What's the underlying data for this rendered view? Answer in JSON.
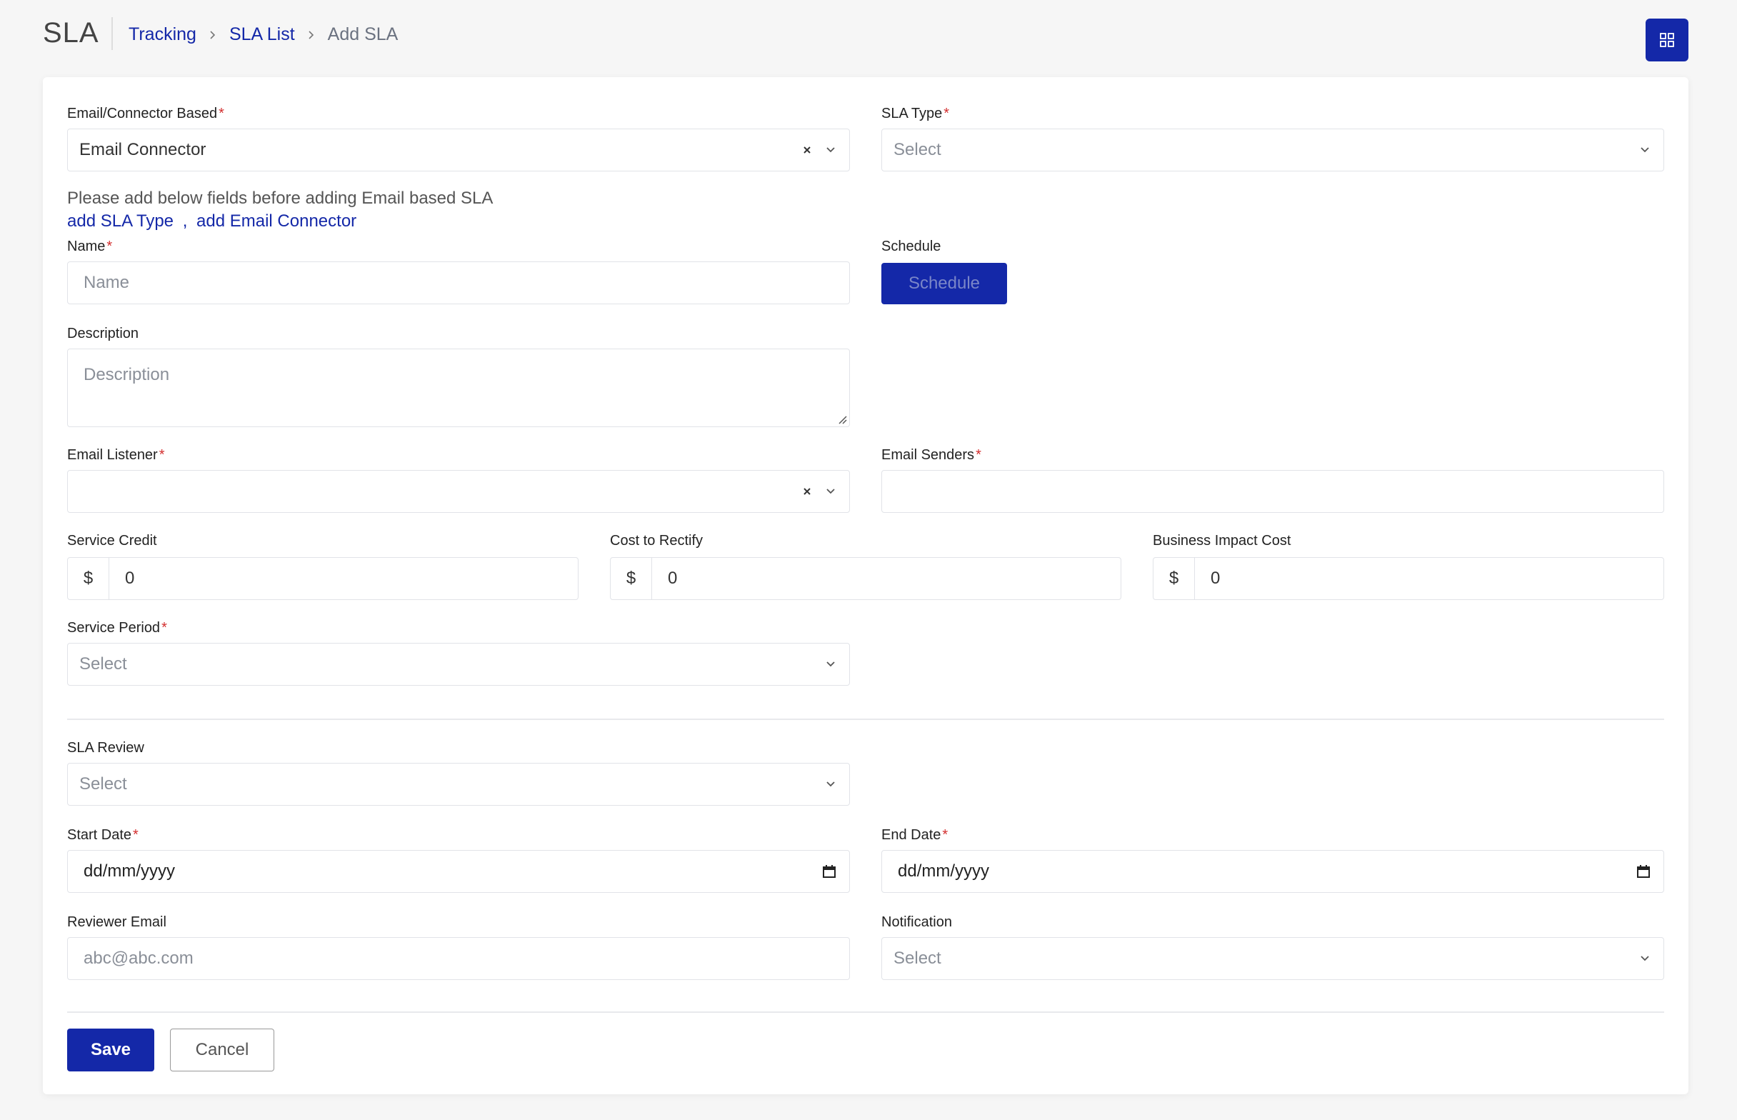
{
  "header": {
    "title": "SLA",
    "breadcrumb": {
      "tracking": "Tracking",
      "sla_list": "SLA List",
      "current": "Add SLA"
    }
  },
  "form": {
    "email_connector_based": {
      "label": "Email/Connector Based",
      "required": "*",
      "value": "Email Connector"
    },
    "sla_type": {
      "label": "SLA Type",
      "required": "*",
      "placeholder": "Select"
    },
    "info": {
      "text": "Please add below fields before adding Email based SLA",
      "link_sla_type": "add SLA Type",
      "separator": ",",
      "link_email_connector": "add Email Connector"
    },
    "name": {
      "label": "Name",
      "required": "*",
      "placeholder": "Name"
    },
    "schedule": {
      "label": "Schedule",
      "button": "Schedule"
    },
    "description": {
      "label": "Description",
      "placeholder": "Description"
    },
    "email_listener": {
      "label": "Email Listener",
      "required": "*",
      "value": ""
    },
    "email_senders": {
      "label": "Email Senders",
      "required": "*",
      "value": ""
    },
    "service_credit": {
      "label": "Service Credit",
      "symbol": "$",
      "value": "0"
    },
    "cost_to_rectify": {
      "label": "Cost to Rectify",
      "symbol": "$",
      "value": "0"
    },
    "business_impact_cost": {
      "label": "Business Impact Cost",
      "symbol": "$",
      "value": "0"
    },
    "service_period": {
      "label": "Service Period",
      "required": "*",
      "placeholder": "Select"
    },
    "sla_review": {
      "label": "SLA Review",
      "placeholder": "Select"
    },
    "start_date": {
      "label": "Start Date",
      "required": "*",
      "value": "dd/mm/yyyy"
    },
    "end_date": {
      "label": "End Date",
      "required": "*",
      "value": "dd/mm/yyyy"
    },
    "reviewer_email": {
      "label": "Reviewer Email",
      "placeholder": "abc@abc.com"
    },
    "notification": {
      "label": "Notification",
      "placeholder": "Select"
    }
  },
  "actions": {
    "save": "Save",
    "cancel": "Cancel"
  },
  "colors": {
    "primary": "#1428a8",
    "required": "#d32f2f",
    "border": "#e1e3e8",
    "background": "#f6f6f6"
  },
  "icons": [
    "chevron-right-icon",
    "grid-icon",
    "clear-icon",
    "chevron-down-icon",
    "calendar-icon",
    "resize-grip-icon"
  ]
}
